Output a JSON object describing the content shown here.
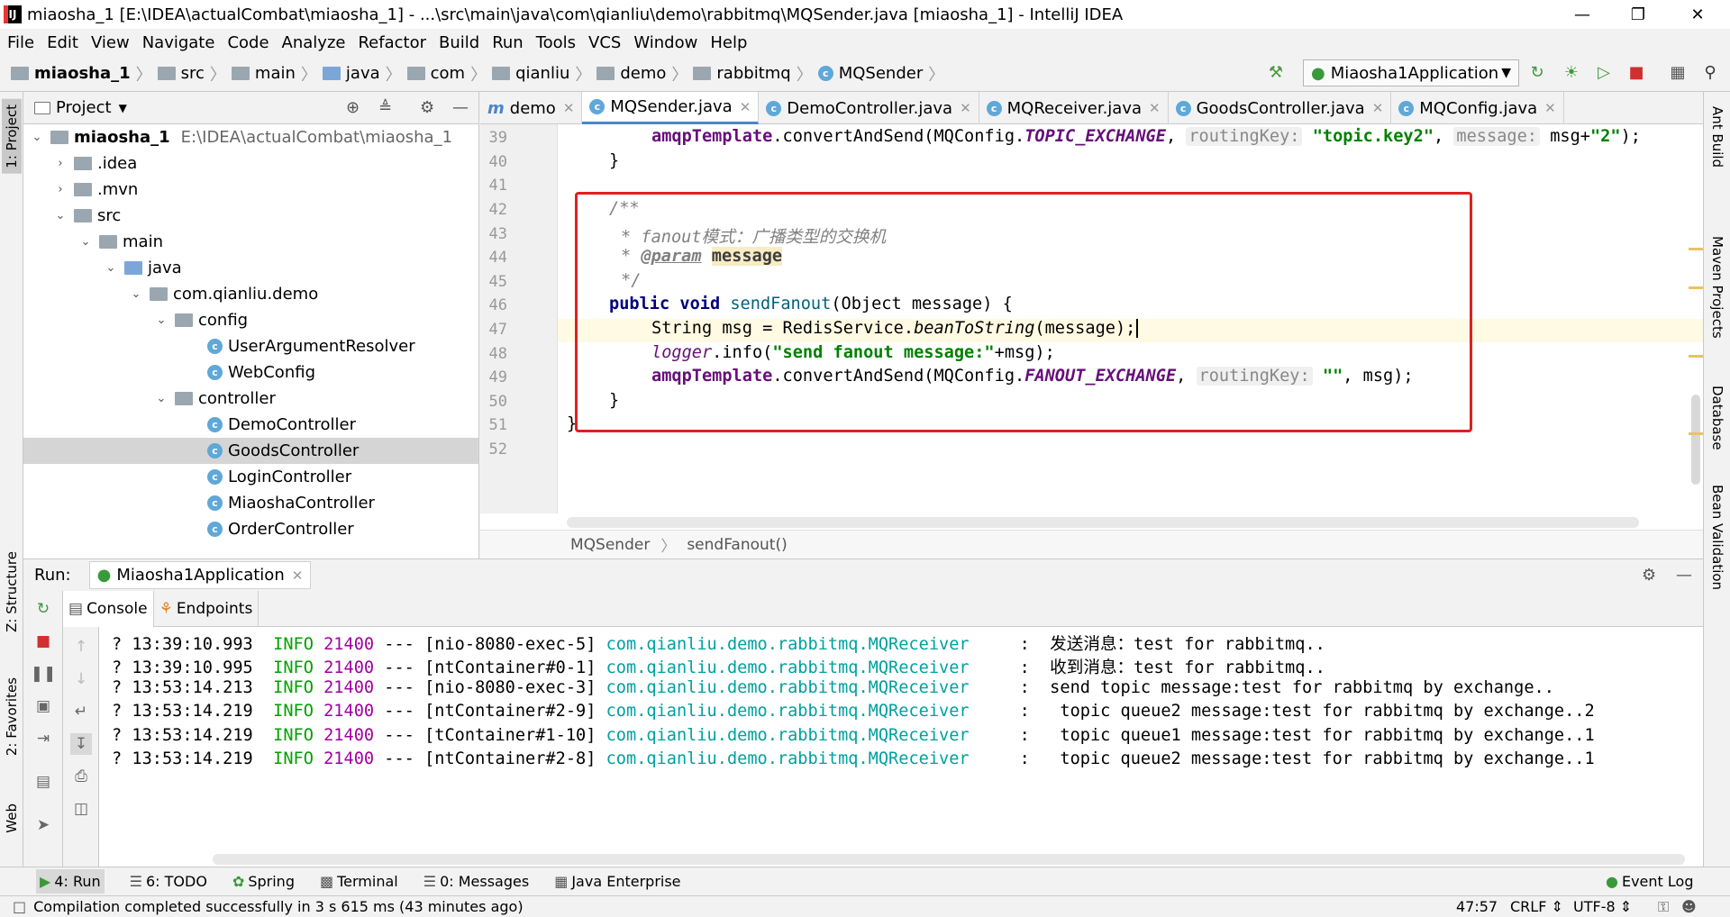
{
  "window": {
    "title": "miaosha_1 [E:\\IDEA\\actualCombat\\miaosha_1] - ...\\src\\main\\java\\com\\qianliu\\demo\\rabbitmq\\MQSender.java [miaosha_1] - IntelliJ IDEA"
  },
  "menu": [
    "File",
    "Edit",
    "View",
    "Navigate",
    "Code",
    "Analyze",
    "Refactor",
    "Build",
    "Run",
    "Tools",
    "VCS",
    "Window",
    "Help"
  ],
  "breadcrumb": [
    "miaosha_1",
    "src",
    "main",
    "java",
    "com",
    "qianliu",
    "demo",
    "rabbitmq",
    "MQSender"
  ],
  "run_config": "Miaosha1Application",
  "project": {
    "header": "Project",
    "root_name": "miaosha_1",
    "root_path": "E:\\IDEA\\actualCombat\\miaosha_1",
    "items": [
      ".idea",
      ".mvn",
      "src",
      "main",
      "java",
      "com.qianliu.demo",
      "config",
      "UserArgumentResolver",
      "WebConfig",
      "controller",
      "DemoController",
      "GoodsController",
      "LoginController",
      "MiaoshaController",
      "OrderController"
    ]
  },
  "tabs": [
    "demo",
    "MQSender.java",
    "DemoController.java",
    "MQReceiver.java",
    "GoodsController.java",
    "MQConfig.java"
  ],
  "editor": {
    "line_numbers": [
      "39",
      "40",
      "41",
      "42",
      "43",
      "44",
      "45",
      "46",
      "47",
      "48",
      "49",
      "50",
      "51",
      "52"
    ],
    "breadcrumb_class": "MQSender",
    "breadcrumb_method": "sendFanout()",
    "l39_a": "amqpTemplate",
    "l39_b": ".convertAndSend(MQConfig.",
    "l39_field": "TOPIC_EXCHANGE",
    "l39_hint1": "routingKey:",
    "l39_str": "\"topic.key2\"",
    "l39_hint2": "message:",
    "l39_tail": "msg+",
    "l39_str2": "\"2\"",
    "l39_end": ");",
    "l40": "}",
    "l42": "/**",
    "l43": "* fanout模式：广播类型的交换机",
    "l44_star": "* ",
    "l44_tag": "@param",
    "l44_name": "message",
    "l45": "*/",
    "l46_kw1": "public",
    "l46_kw2": "void",
    "l46_name": "sendFanout",
    "l46_rest": "(Object message) {",
    "l47_a": "String msg = RedisService.",
    "l47_m": "beanToString",
    "l47_b": "(message);",
    "l48_logger": "logger",
    "l48_a": ".info(",
    "l48_str": "\"send fanout message:\"",
    "l48_b": "+msg);",
    "l49_a": "amqpTemplate",
    "l49_b": ".convertAndSend(MQConfig.",
    "l49_field": "FANOUT_EXCHANGE",
    "l49_hint": "routingKey:",
    "l49_str": "\"\"",
    "l49_end": ", msg);",
    "l50": "}",
    "l51": "}"
  },
  "run": {
    "label": "Run:",
    "app": "Miaosha1Application",
    "tab_console": "Console",
    "tab_endpoints": "Endpoints",
    "log": [
      {
        "t": "13:39:10.993",
        "lvl": "INFO",
        "pid": "21400",
        "sep": "---",
        "thread": "[nio-8080-exec-5]",
        "cls": "com.qianliu.demo.rabbitmq.MQReceiver",
        "msg": ":  发送消息：test for rabbitmq.."
      },
      {
        "t": "13:39:10.995",
        "lvl": "INFO",
        "pid": "21400",
        "sep": "---",
        "thread": "[ntContainer#0-1]",
        "cls": "com.qianliu.demo.rabbitmq.MQReceiver",
        "msg": ":  收到消息：test for rabbitmq.."
      },
      {
        "t": "13:53:14.213",
        "lvl": "INFO",
        "pid": "21400",
        "sep": "---",
        "thread": "[nio-8080-exec-3]",
        "cls": "com.qianliu.demo.rabbitmq.MQReceiver",
        "msg": ":  send topic message:test for rabbitmq by exchange.."
      },
      {
        "t": "13:53:14.219",
        "lvl": "INFO",
        "pid": "21400",
        "sep": "---",
        "thread": "[ntContainer#2-9]",
        "cls": "com.qianliu.demo.rabbitmq.MQReceiver",
        "msg": ":   topic queue2 message:test for rabbitmq by exchange..2"
      },
      {
        "t": "13:53:14.219",
        "lvl": "INFO",
        "pid": "21400",
        "sep": "---",
        "thread": "[tContainer#1-10]",
        "cls": "com.qianliu.demo.rabbitmq.MQReceiver",
        "msg": ":   topic queue1 message:test for rabbitmq by exchange..1"
      },
      {
        "t": "13:53:14.219",
        "lvl": "INFO",
        "pid": "21400",
        "sep": "---",
        "thread": "[ntContainer#2-8]",
        "cls": "com.qianliu.demo.rabbitmq.MQReceiver",
        "msg": ":   topic queue2 message:test for rabbitmq by exchange..1"
      }
    ]
  },
  "left_tabs": {
    "project": "1: Project",
    "structure": "Z: Structure",
    "favorites": "2: Favorites",
    "web": "Web"
  },
  "right_tabs": {
    "ant": "Ant Build",
    "maven": "Maven Projects",
    "database": "Database",
    "bean": "Bean Validation"
  },
  "bottom_tabs": [
    "4: Run",
    "6: TODO",
    "Spring",
    "Terminal",
    "0: Messages",
    "Java Enterprise",
    "Event Log"
  ],
  "status": {
    "message": "Compilation completed successfully in 3 s 615 ms (43 minutes ago)",
    "position": "47:57",
    "line_sep": "CRLF",
    "encoding": "UTF-8"
  },
  "colors": {
    "accent": "#4a86c7",
    "highlight_box": "#e02020",
    "info": "#00a000",
    "class_name": "#00a0a0"
  }
}
